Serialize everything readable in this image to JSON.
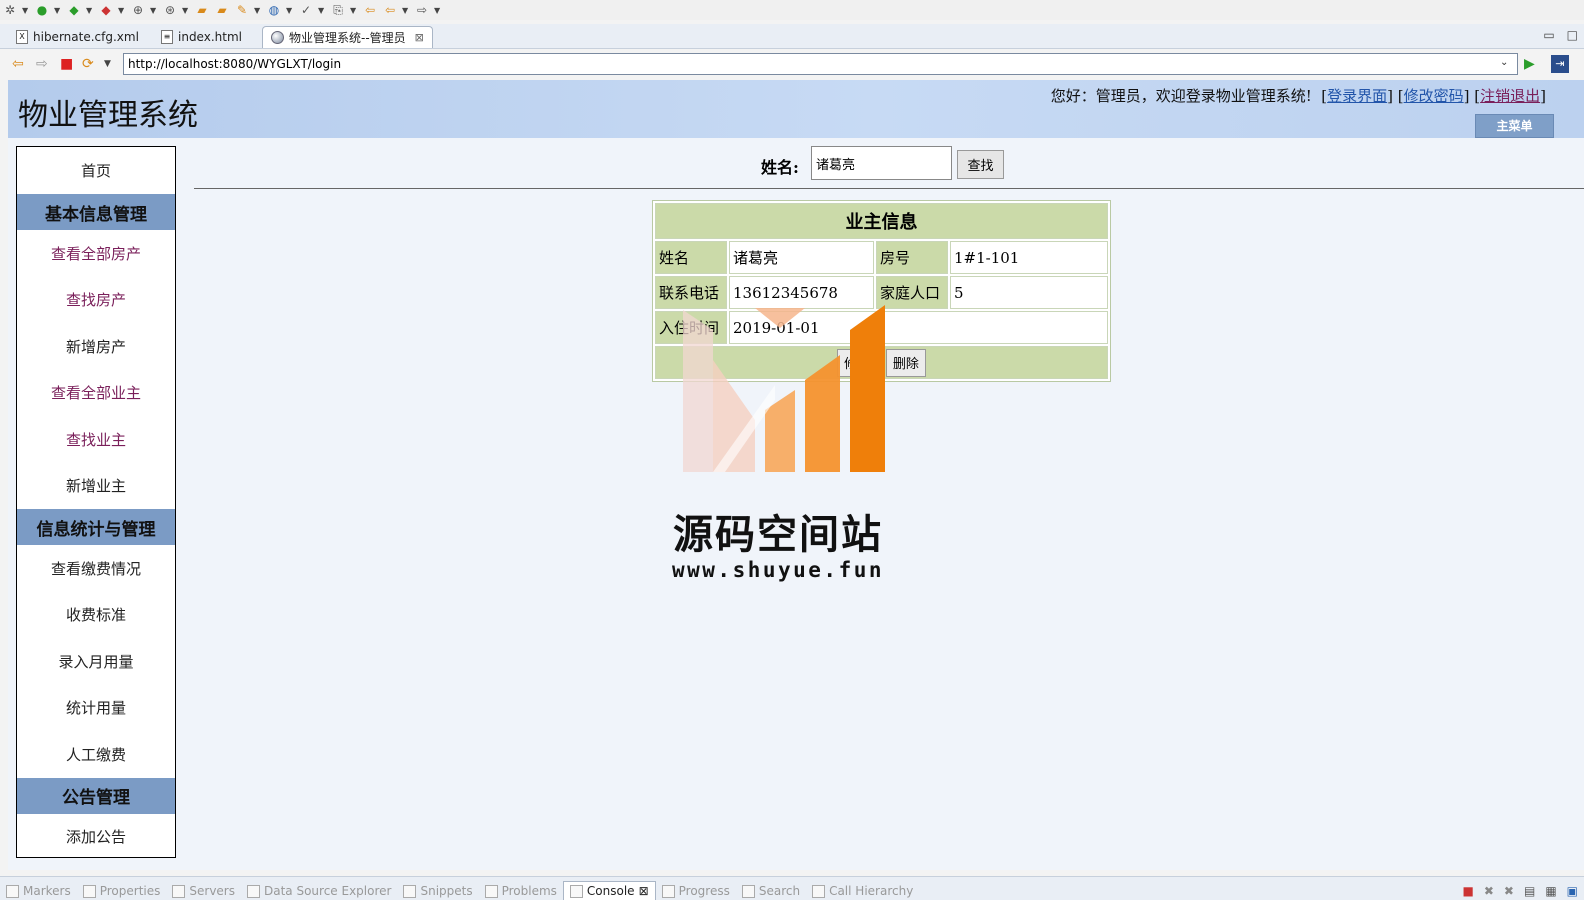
{
  "ide": {
    "editor_tabs": [
      {
        "label": "hibernate.cfg.xml",
        "icon": "xml-file-icon"
      },
      {
        "label": "index.html",
        "icon": "html-file-icon"
      },
      {
        "label": "物业管理系统--管理员",
        "icon": "globe-icon",
        "active": true
      }
    ],
    "url": "http://localhost:8080/WYGLXT/login",
    "views": [
      {
        "label": "Markers"
      },
      {
        "label": "Properties"
      },
      {
        "label": "Servers"
      },
      {
        "label": "Data Source Explorer"
      },
      {
        "label": "Snippets"
      },
      {
        "label": "Problems"
      },
      {
        "label": "Console",
        "active": true
      },
      {
        "label": "Progress"
      },
      {
        "label": "Search"
      },
      {
        "label": "Call Hierarchy"
      }
    ]
  },
  "site": {
    "title": "物业管理系统",
    "welcome_text": "您好：管理员，欢迎登录物业管理系统!",
    "links": {
      "login_page": "登录界面",
      "change_password": "修改密码",
      "logout": "注销退出"
    },
    "main_menu": "主菜单"
  },
  "sidebar": {
    "home": "首页",
    "section_basic": "基本信息管理",
    "basic_items": [
      "查看全部房产",
      "查找房产",
      "新增房产",
      "查看全部业主",
      "查找业主",
      "新增业主"
    ],
    "section_stats": "信息统计与管理",
    "stats_items": [
      "查看缴费情况",
      "收费标准",
      "录入月用量",
      "统计用量",
      "人工缴费"
    ],
    "section_notice": "公告管理",
    "notice_items": [
      "添加公告"
    ]
  },
  "search": {
    "label": "姓名:",
    "value": "诸葛亮",
    "button": "查找"
  },
  "owner": {
    "caption": "业主信息",
    "name_label": "姓名",
    "name": "诸葛亮",
    "room_label": "房号",
    "room": "1#1-101",
    "phone_label": "联系电话",
    "phone": "13612345678",
    "family_label": "家庭人口",
    "family": "5",
    "checkin_label": "入住时间",
    "checkin": "2019-01-01",
    "edit_button": "修改",
    "delete_button": "删除"
  },
  "watermark": {
    "text": "源码空间站",
    "url": "www.shuyue.fun"
  }
}
